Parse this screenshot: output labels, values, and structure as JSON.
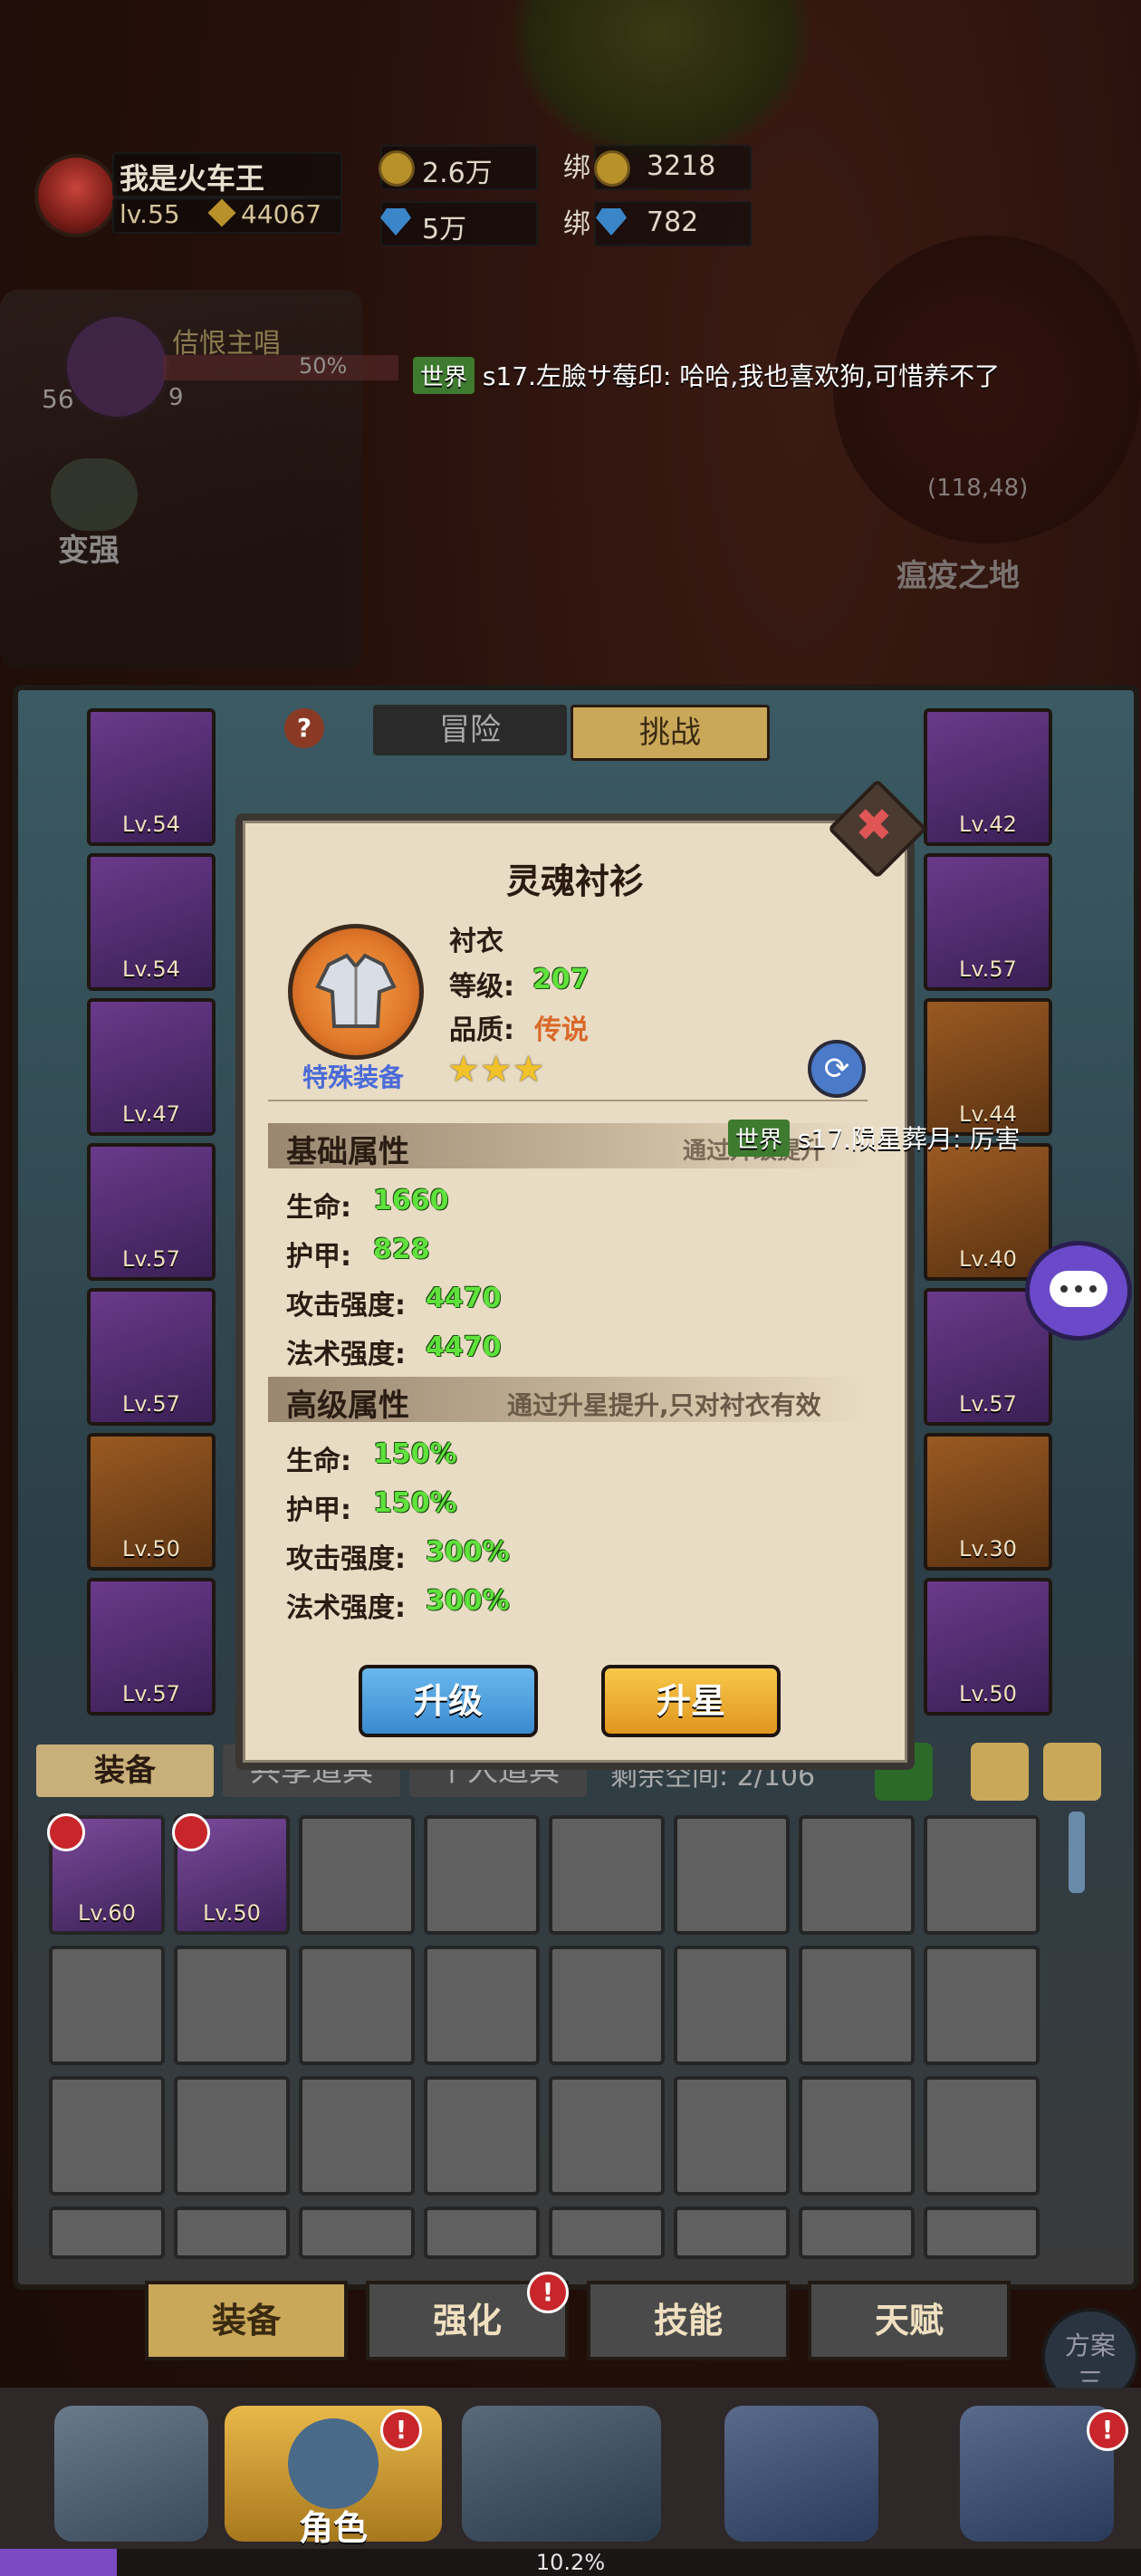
{
  "player": {
    "name": "我是火车王",
    "level": "lv.55",
    "power": "44067"
  },
  "currency": {
    "gold": "2.6万",
    "bound_gold": "3218",
    "gems": "5万",
    "bound_gems": "782",
    "bound_label": "绑"
  },
  "hud": {
    "side_player_name": "佶恨主唱",
    "side_percent": "50%",
    "side_level": "56",
    "side_count": "9",
    "become_strong": "变强",
    "map_coords": "(118,48)",
    "map_name": "瘟疫之地"
  },
  "chat": [
    {
      "channel": "世界",
      "text": "s17.左臉サ莓印: 哈哈,我也喜欢狗,可惜养不了"
    },
    {
      "channel": "世界",
      "text": "s17.陨星葬月: 厉害"
    }
  ],
  "top_tabs": [
    "冒险",
    "挑战"
  ],
  "left_slots": [
    "Lv.54",
    "Lv.54",
    "Lv.47",
    "Lv.57",
    "Lv.57",
    "Lv.50",
    "Lv.57"
  ],
  "right_slots": [
    "Lv.42",
    "Lv.57",
    "Lv.44",
    "Lv.40",
    "Lv.57",
    "Lv.30",
    "Lv.50"
  ],
  "dialog": {
    "title": "灵魂衬衫",
    "item_type": "衬衣",
    "level_label": "等级:",
    "level_value": "207",
    "quality_label": "品质:",
    "quality_value": "传说",
    "special_tag": "特殊装备",
    "stars": 3,
    "basic_section": "基础属性",
    "basic_note": "通过升级提升",
    "basic_attrs": [
      {
        "label": "生命:",
        "value": "1660"
      },
      {
        "label": "护甲:",
        "value": "828"
      },
      {
        "label": "攻击强度:",
        "value": "4470"
      },
      {
        "label": "法术强度:",
        "value": "4470"
      }
    ],
    "advanced_section": "高级属性",
    "advanced_note": "通过升星提升,只对衬衣有效",
    "advanced_attrs": [
      {
        "label": "生命:",
        "value": "150%"
      },
      {
        "label": "护甲:",
        "value": "150%"
      },
      {
        "label": "攻击强度:",
        "value": "300%"
      },
      {
        "label": "法术强度:",
        "value": "300%"
      }
    ],
    "upgrade_button": "升级",
    "star_button": "升星"
  },
  "inventory": {
    "tabs": [
      "装备",
      "共享道具",
      "个人道具"
    ],
    "space": "剩余空间: 2/106",
    "items": [
      {
        "level": "Lv.60"
      },
      {
        "level": "Lv.50"
      }
    ]
  },
  "nav_tabs": [
    "装备",
    "强化",
    "技能",
    "天赋"
  ],
  "bottom_nav": {
    "active_label": "角色",
    "scheme_label": "方案",
    "scheme_num": "三"
  },
  "progress": {
    "text": "10.2%",
    "fraction": 0.102
  },
  "colors": {
    "gold_button": "#f2b32a",
    "blue_button": "#4aa4e0",
    "green_value": "#5fe23c",
    "legend_orange": "#d9692a",
    "world_tag": "#3e7a2f"
  }
}
